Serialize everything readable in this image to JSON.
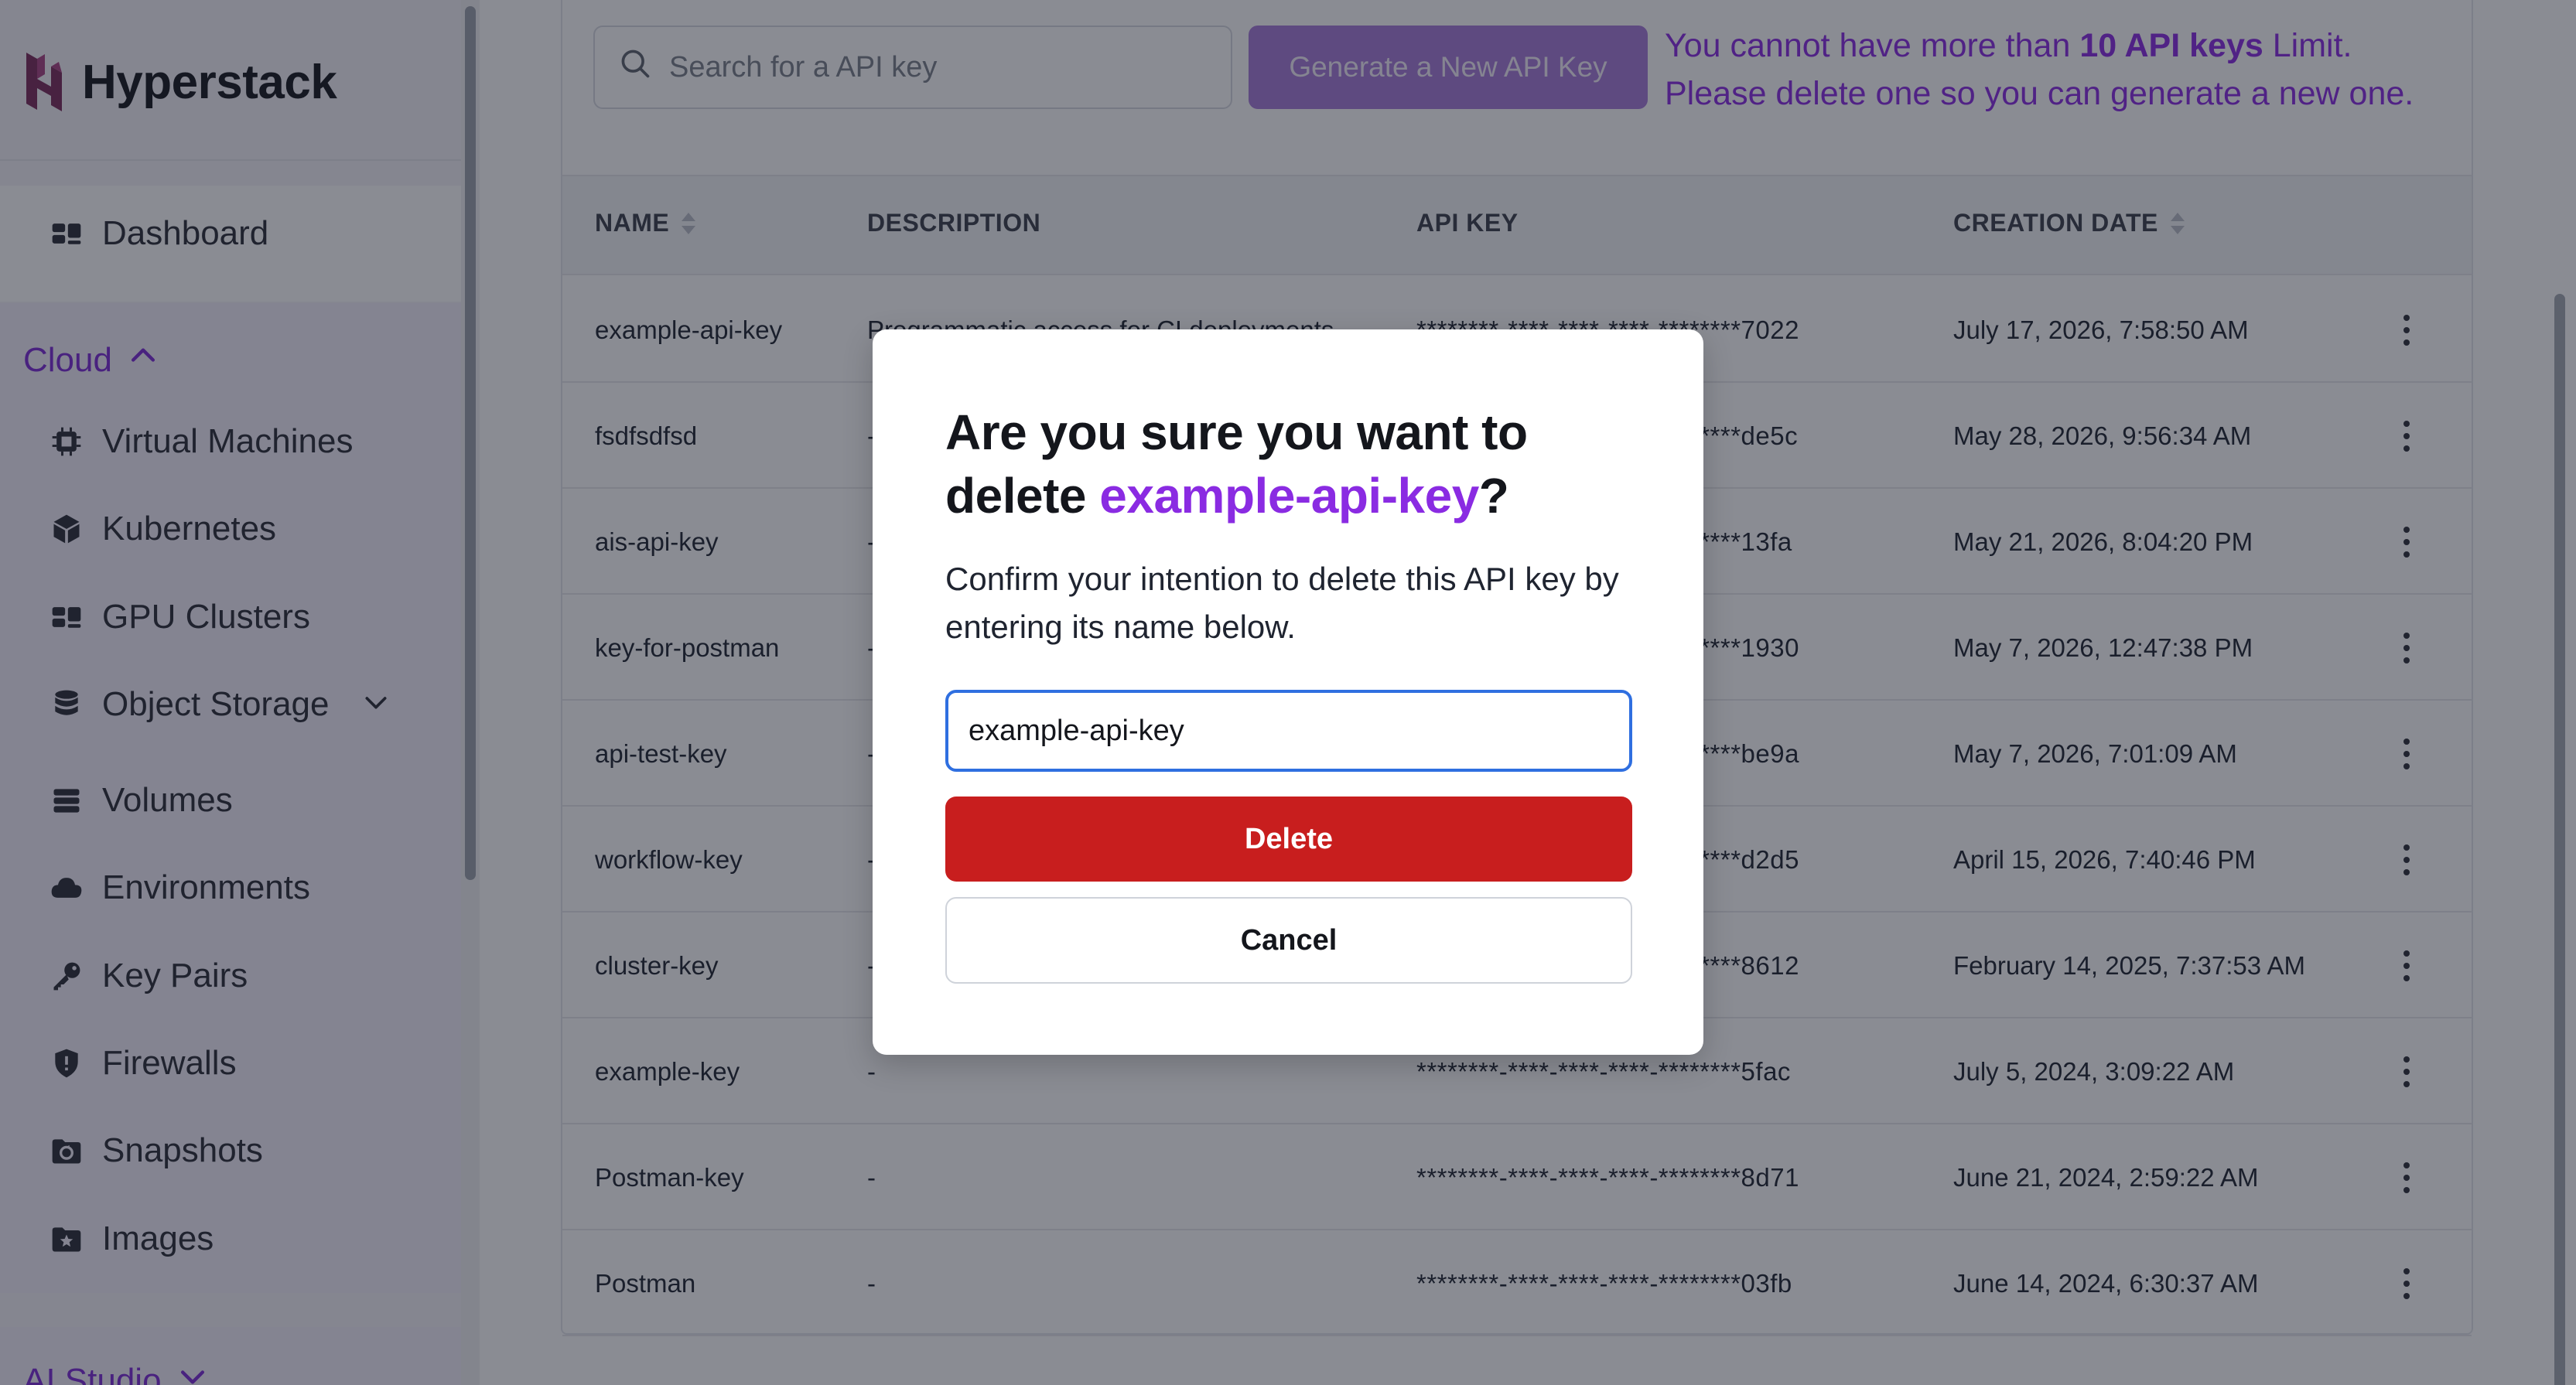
{
  "brand": {
    "name": "Hyperstack"
  },
  "sidebar": {
    "dashboard": "Dashboard",
    "cloud_section": "Cloud",
    "items": [
      {
        "label": "Virtual Machines",
        "icon": "chip-icon"
      },
      {
        "label": "Kubernetes",
        "icon": "cube-icon"
      },
      {
        "label": "GPU Clusters",
        "icon": "grid-icon"
      },
      {
        "label": "Object Storage",
        "icon": "database-icon"
      },
      {
        "label": "Volumes",
        "icon": "volumes-icon"
      },
      {
        "label": "Environments",
        "icon": "cloud-icon"
      },
      {
        "label": "Key Pairs",
        "icon": "key-icon"
      },
      {
        "label": "Firewalls",
        "icon": "shield-icon"
      },
      {
        "label": "Snapshots",
        "icon": "snapshot-icon"
      },
      {
        "label": "Images",
        "icon": "image-icon"
      }
    ],
    "ai_section": "AI Studio"
  },
  "toolbar": {
    "search_placeholder": "Search for a API key",
    "generate_label": "Generate a New API Key",
    "limit_prefix": "You cannot have more than ",
    "limit_bold": "10 API keys",
    "limit_suffix": " Limit.",
    "limit_line2": "Please delete one so you can generate a new one."
  },
  "table": {
    "headers": {
      "name": "NAME",
      "description": "DESCRIPTION",
      "api_key": "API KEY",
      "creation_date": "CREATION DATE"
    },
    "rows": [
      {
        "name": "example-api-key",
        "description": "Programmatic access for CI deployments",
        "api_key": "********-****-****-****-********7022",
        "date": "July 17, 2026, 7:58:50 AM"
      },
      {
        "name": "fsdfsdfsd",
        "description": "-",
        "api_key": "********-****-****-****-********de5c",
        "date": "May 28, 2026, 9:56:34 AM"
      },
      {
        "name": "ais-api-key",
        "description": "-",
        "api_key": "********-****-****-****-********13fa",
        "date": "May 21, 2026, 8:04:20 PM"
      },
      {
        "name": "key-for-postman",
        "description": "-",
        "api_key": "********-****-****-****-********1930",
        "date": "May 7, 2026, 12:47:38 PM"
      },
      {
        "name": "api-test-key",
        "description": "-",
        "api_key": "********-****-****-****-********be9a",
        "date": "May 7, 2026, 7:01:09 AM"
      },
      {
        "name": "workflow-key",
        "description": "-",
        "api_key": "********-****-****-****-********d2d5",
        "date": "April 15, 2026, 7:40:46 PM"
      },
      {
        "name": "cluster-key",
        "description": "-",
        "api_key": "********-****-****-****-********8612",
        "date": "February 14, 2025, 7:37:53 AM"
      },
      {
        "name": "example-key",
        "description": "-",
        "api_key": "********-****-****-****-********5fac",
        "date": "July 5, 2024, 3:09:22 AM"
      },
      {
        "name": "Postman-key",
        "description": "-",
        "api_key": "********-****-****-****-********8d71",
        "date": "June 21, 2024, 2:59:22 AM"
      },
      {
        "name": "Postman",
        "description": "-",
        "api_key": "********-****-****-****-********03fb",
        "date": "June 14, 2024, 6:30:37 AM"
      }
    ]
  },
  "modal": {
    "title_prefix": "Are you sure you want to delete ",
    "title_key": "example-api-key",
    "title_suffix": "?",
    "body": "Confirm your intention to delete this API key by entering its name below.",
    "input_value": "example-api-key",
    "delete_label": "Delete",
    "cancel_label": "Cancel"
  },
  "colors": {
    "accent": "#8a2be2",
    "danger": "#c81e1e",
    "focus": "#2f6fe0"
  }
}
